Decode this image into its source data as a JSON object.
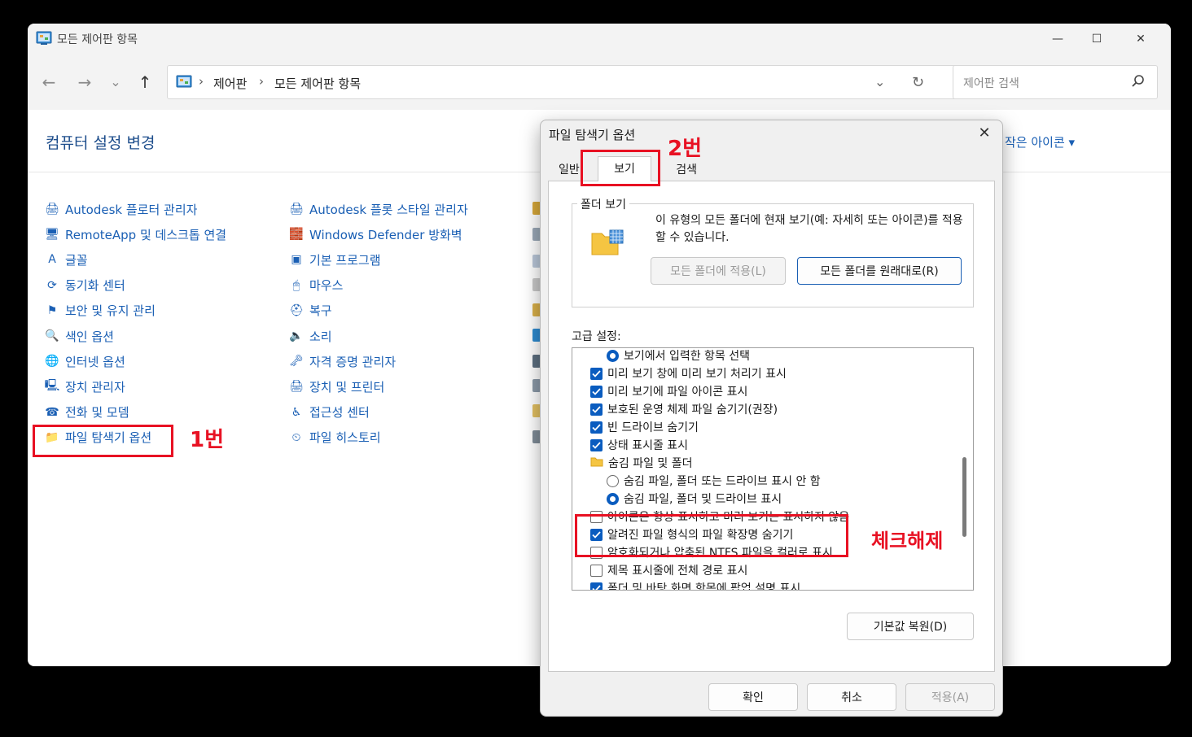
{
  "window": {
    "title": "모든 제어판 항목",
    "controls": {
      "minimize": "—",
      "maximize": "☐",
      "close": "✕"
    }
  },
  "nav": {
    "back": "←",
    "forward": "→",
    "recent": "⌄",
    "up": "↑",
    "breadcrumb": [
      "제어판",
      "모든 제어판 항목"
    ],
    "dropdown": "⌄",
    "refresh": "↻",
    "search_placeholder": "제어판 검색"
  },
  "page": {
    "title": "컴퓨터 설정 변경",
    "view_by": "작은 아이콘 ▾"
  },
  "items_col1": [
    {
      "label": "Autodesk 플로터 관리자",
      "icon": "printer-icon",
      "glyph": "🖨"
    },
    {
      "label": "RemoteApp 및 데스크톱 연결",
      "icon": "remote-desktop-icon",
      "glyph": "🖥"
    },
    {
      "label": "글꼴",
      "icon": "font-icon",
      "glyph": "A"
    },
    {
      "label": "동기화 센터",
      "icon": "sync-icon",
      "glyph": "⟳"
    },
    {
      "label": "보안 및 유지 관리",
      "icon": "flag-icon",
      "glyph": "⚑"
    },
    {
      "label": "색인 옵션",
      "icon": "indexing-icon",
      "glyph": "🔍"
    },
    {
      "label": "인터넷 옵션",
      "icon": "internet-options-icon",
      "glyph": "🌐"
    },
    {
      "label": "장치 관리자",
      "icon": "device-manager-icon",
      "glyph": "🖳"
    },
    {
      "label": "전화 및 모뎀",
      "icon": "phone-modem-icon",
      "glyph": "☎"
    },
    {
      "label": "파일 탐색기 옵션",
      "icon": "folder-options-icon",
      "glyph": "📁"
    }
  ],
  "items_col2": [
    {
      "label": "Autodesk 플롯 스타일 관리자",
      "icon": "plot-style-icon",
      "glyph": "🖨"
    },
    {
      "label": "Windows Defender 방화벽",
      "icon": "firewall-icon",
      "glyph": "🧱"
    },
    {
      "label": "기본 프로그램",
      "icon": "default-programs-icon",
      "glyph": "▣"
    },
    {
      "label": "마우스",
      "icon": "mouse-icon",
      "glyph": "🖱"
    },
    {
      "label": "복구",
      "icon": "recovery-icon",
      "glyph": "⛑"
    },
    {
      "label": "소리",
      "icon": "sound-icon",
      "glyph": "🔈"
    },
    {
      "label": "자격 증명 관리자",
      "icon": "credential-icon",
      "glyph": "🗝"
    },
    {
      "label": "장치 및 프린터",
      "icon": "devices-printers-icon",
      "glyph": "🖨"
    },
    {
      "label": "접근성 센터",
      "icon": "accessibility-icon",
      "glyph": "♿"
    },
    {
      "label": "파일 히스토리",
      "icon": "file-history-icon",
      "glyph": "⏲"
    }
  ],
  "annotations": {
    "step1": "1번",
    "step2": "2번",
    "uncheck": "체크해제",
    "color": "#e81123"
  },
  "dialog": {
    "title": "파일 탐색기 옵션",
    "close": "✕",
    "tabs": {
      "general": "일반",
      "view": "보기",
      "search": "검색"
    },
    "folder_views": {
      "label": "폴더 보기",
      "description": "이 유형의 모든 폴더에 현재 보기(예: 자세히 또는 아이콘)를 적용할 수 있습니다.",
      "apply_button": "모든 폴더에 적용(L)",
      "reset_button": "모든 폴더를 원래대로(R)"
    },
    "advanced_label": "고급 설정:",
    "advanced_items": [
      {
        "type": "radio",
        "checked": true,
        "indent": 1,
        "label": "보기에서 입력한 항목 선택"
      },
      {
        "type": "check",
        "checked": true,
        "indent": 0,
        "label": "미리 보기 창에 미리 보기 처리기 표시"
      },
      {
        "type": "check",
        "checked": true,
        "indent": 0,
        "label": "미리 보기에 파일 아이콘 표시"
      },
      {
        "type": "check",
        "checked": true,
        "indent": 0,
        "label": "보호된 운영 체제 파일 숨기기(권장)"
      },
      {
        "type": "check",
        "checked": true,
        "indent": 0,
        "label": "빈 드라이브 숨기기"
      },
      {
        "type": "check",
        "checked": true,
        "indent": 0,
        "label": "상태 표시줄 표시"
      },
      {
        "type": "folder",
        "checked": false,
        "indent": 0,
        "label": "숨김 파일 및 폴더"
      },
      {
        "type": "radio",
        "checked": false,
        "indent": 1,
        "label": "숨김 파일, 폴더 또는 드라이브 표시 안 함"
      },
      {
        "type": "radio",
        "checked": true,
        "indent": 1,
        "label": "숨김 파일, 폴더 및 드라이브 표시"
      },
      {
        "type": "check",
        "checked": false,
        "indent": 0,
        "label": "아이콘은 항상 표시하고 미리 보기는 표시하지 않음"
      },
      {
        "type": "check",
        "checked": true,
        "indent": 0,
        "label": "알려진 파일 형식의 파일 확장명 숨기기"
      },
      {
        "type": "check",
        "checked": false,
        "indent": 0,
        "label": "암호화되거나 압축된 NTFS 파일을 컬러로 표시"
      },
      {
        "type": "check",
        "checked": false,
        "indent": 0,
        "label": "제목 표시줄에 전체 경로 표시"
      },
      {
        "type": "check",
        "checked": true,
        "indent": 0,
        "label": "폴더 및 바탕 화면 항목에 팝업 설명 표시"
      }
    ],
    "restore_defaults": "기본값 복원(D)",
    "ok": "확인",
    "cancel": "취소",
    "apply": "적용(A)"
  },
  "colors": {
    "link": "#1a5fb4",
    "checkbox": "#0a5cbf",
    "title": "#1e4e8c"
  }
}
